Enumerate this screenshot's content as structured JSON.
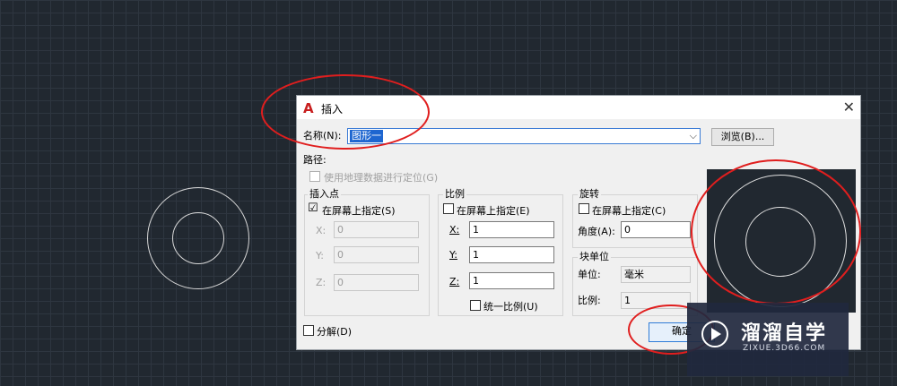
{
  "dialog": {
    "title": "插入",
    "logo_glyph": "A",
    "close_glyph": "✕",
    "name_label": "名称(N):",
    "name_value": "图形一",
    "browse_label": "浏览(B)...",
    "path_label": "路径:",
    "geo_label": "使用地理数据进行定位(G)",
    "insertion": {
      "title": "插入点",
      "onscreen_label": "在屏幕上指定(S)",
      "onscreen_checked": "☑",
      "x_label": "X:",
      "x_value": "0",
      "y_label": "Y:",
      "y_value": "0",
      "z_label": "Z:",
      "z_value": "0"
    },
    "scale": {
      "title": "比例",
      "onscreen_label": "在屏幕上指定(E)",
      "x_label": "X:",
      "x_value": "1",
      "y_label": "Y:",
      "y_value": "1",
      "z_label": "Z:",
      "z_value": "1",
      "uniform_label": "统一比例(U)"
    },
    "rotation": {
      "title": "旋转",
      "onscreen_label": "在屏幕上指定(C)",
      "angle_label": "角度(A):",
      "angle_value": "0"
    },
    "block_unit": {
      "title": "块单位",
      "unit_label": "单位:",
      "unit_value": "毫米",
      "factor_label": "比例:",
      "factor_value": "1"
    },
    "explode_label": "分解(D)",
    "ok_label": "确定",
    "combo_arrow": "⌵"
  },
  "watermark": {
    "brand": "溜溜自学",
    "site": "ZIXUE.3D66.COM"
  },
  "colors": {
    "canvas_bg": "#212830",
    "annotation_red": "#e01e1e",
    "selection_blue": "#1e66d0"
  }
}
